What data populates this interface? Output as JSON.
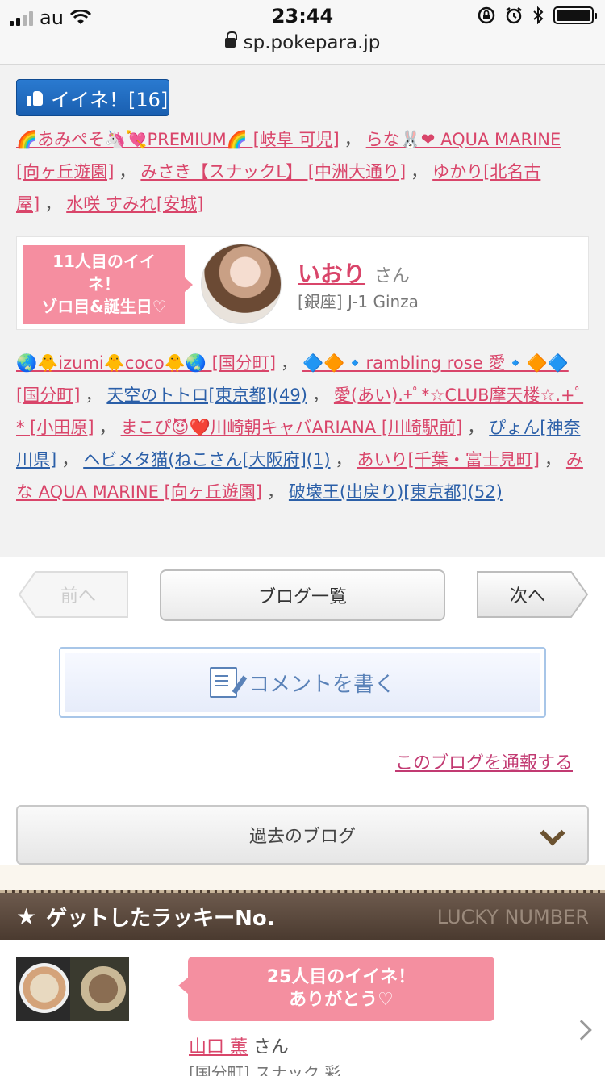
{
  "status_bar": {
    "carrier": "au",
    "time": "23:44",
    "url": "sp.pokepara.jp"
  },
  "like_button": {
    "label": "イイネ！[16]"
  },
  "likers_top": [
    {
      "text": "🌈あみぺそ🦄💘PREMIUM🌈 [岐阜 可児]",
      "sep": "，"
    },
    {
      "text": "らな🐰❤ AQUA MARINE [向ヶ丘遊園]",
      "sep": "，"
    },
    {
      "text": "みさき【スナックL】 [中洲大通り]",
      "sep": "，"
    },
    {
      "text": "ゆかり[北名古屋]",
      "sep": "，"
    },
    {
      "text": "水咲 すみれ[安城]",
      "sep": ""
    }
  ],
  "featured": {
    "badge_line1": "11人目のイイ",
    "badge_line2": "ネ！",
    "badge_line3": "ゾロ目&誕生日♡",
    "name": "いおり",
    "honorific": "さん",
    "shop": "[銀座] J-1 Ginza"
  },
  "likers_bottom": [
    {
      "text": "🌏🐥izumi🐥coco🐥🌏 [国分町]",
      "sep": "，",
      "color": "pink"
    },
    {
      "text": "🔷🔶🔹rambling rose 愛🔹🔶🔷 [国分町]",
      "sep": "，",
      "color": "pink"
    },
    {
      "text": "天空のトトロ[東京都](49)",
      "sep": "，",
      "color": "blue"
    },
    {
      "text": "愛(あい).+ﾟ*☆CLUB摩天楼☆.+ﾟ* [小田原]",
      "sep": "，",
      "color": "pink"
    },
    {
      "text": "まこぴ😈❤️川崎朝キャバARIANA [川崎駅前]",
      "sep": "，",
      "color": "pink"
    },
    {
      "text": "ぴょん[神奈川県]",
      "sep": "，",
      "color": "blue"
    },
    {
      "text": "ヘビメタ猫(ねこさん[大阪府](1)",
      "sep": "，",
      "color": "blue"
    },
    {
      "text": "あいり[千葉・富士見町]",
      "sep": "，",
      "color": "pink"
    },
    {
      "text": "みな AQUA MARINE [向ヶ丘遊園]",
      "sep": "，",
      "color": "pink"
    },
    {
      "text": "破壊王(出戻り)[東京都](52)",
      "sep": "",
      "color": "blue"
    }
  ],
  "nav": {
    "prev": "前へ",
    "list": "ブログ一覧",
    "next": "次へ"
  },
  "comment_button": "コメントを書く",
  "report_link": "このブログを通報する",
  "past_blog": "過去のブログ",
  "lucky_section": {
    "title": "ゲットしたラッキーNo.",
    "title_en": "LUCKY NUMBER",
    "badge_line1": "25人目のイイネ！",
    "badge_line2": "ありがとう♡",
    "name": "山口 薫",
    "honorific": "さん",
    "shop": "[国分町] スナック 彩"
  },
  "icons": [
    "wifi-icon",
    "lock-icon",
    "alarm-icon",
    "bluetooth-icon",
    "battery-icon",
    "thumbs-up-icon",
    "document-pen-icon",
    "chevron-down-icon",
    "star-icon",
    "chevron-right-icon"
  ]
}
